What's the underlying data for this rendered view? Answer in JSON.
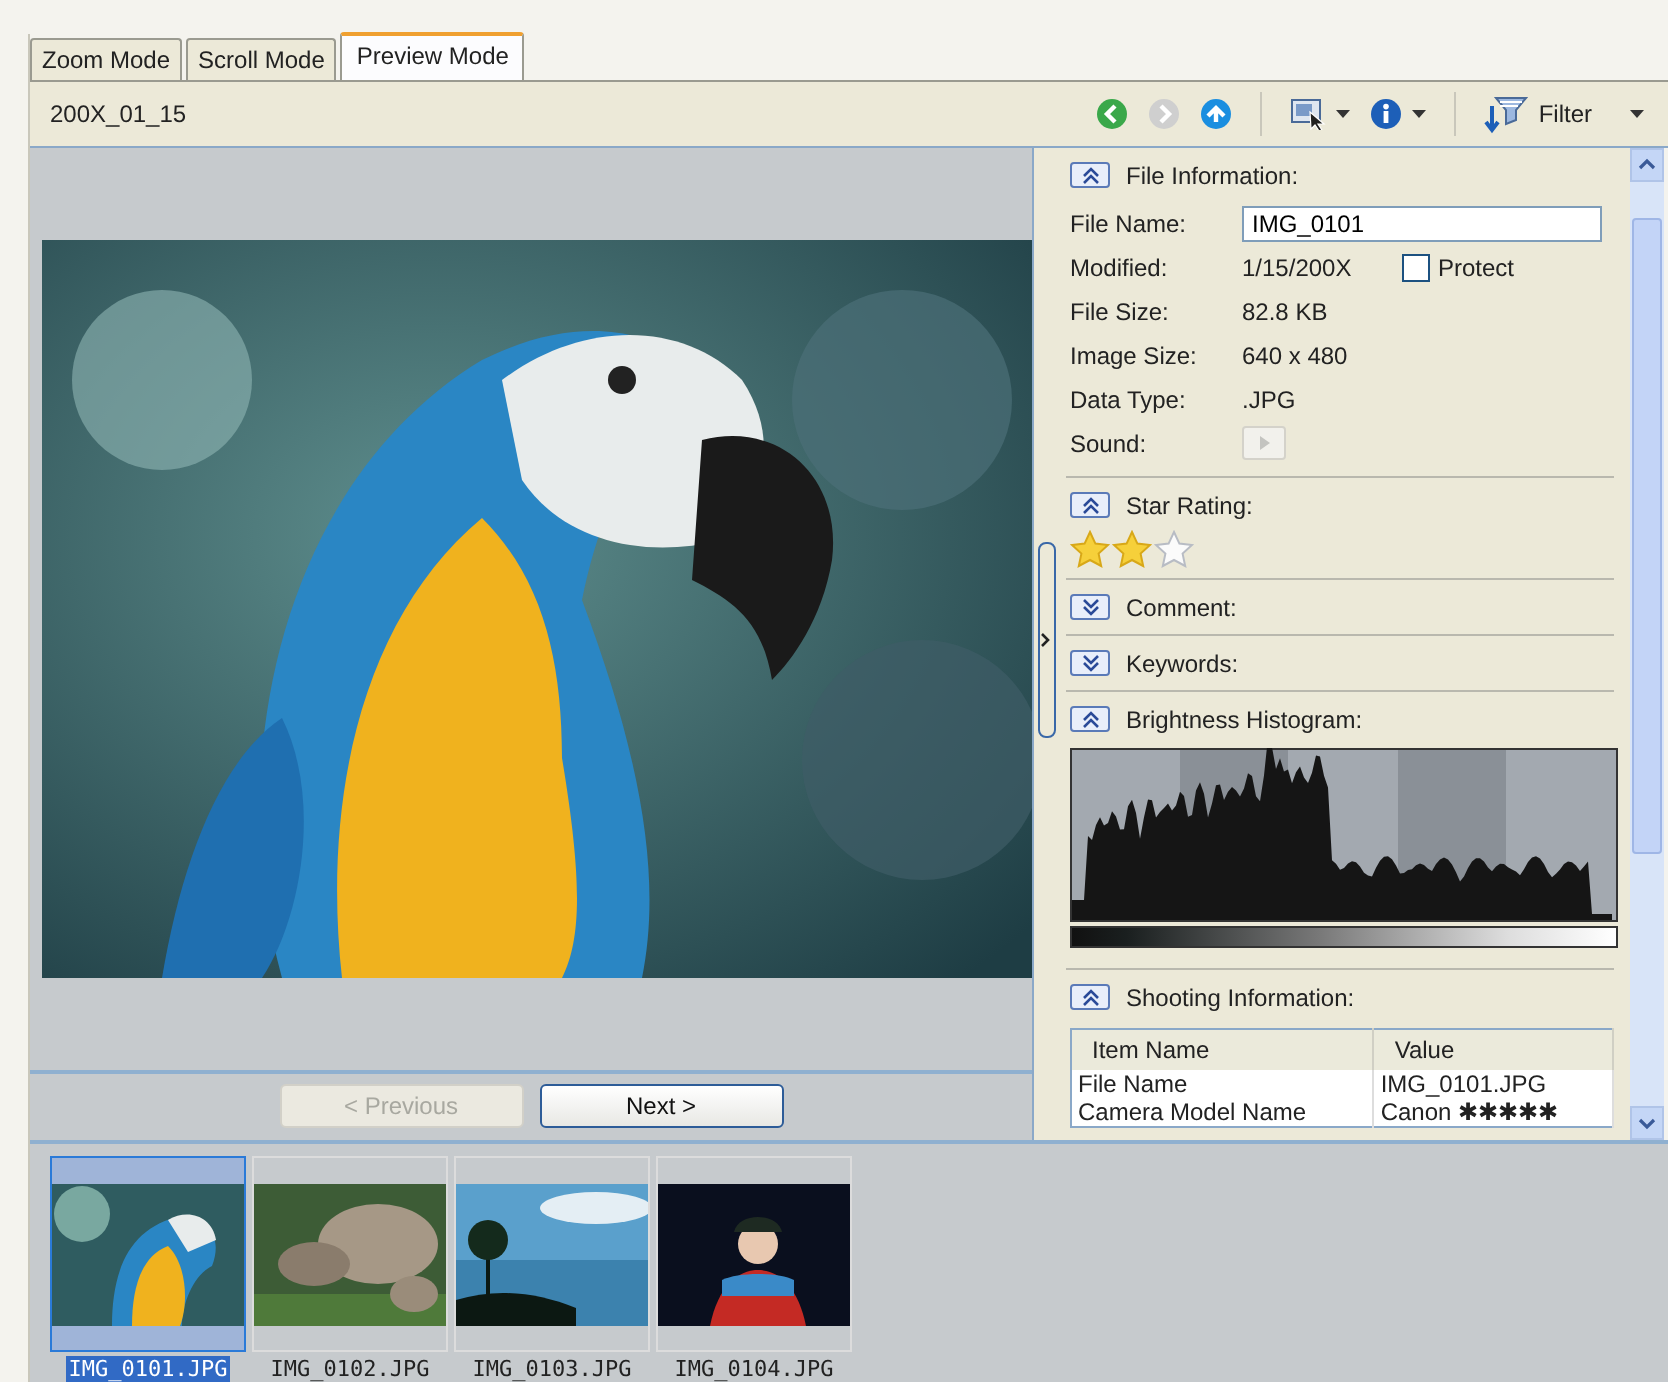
{
  "tabs": [
    {
      "label": "Zoom Mode",
      "selected": false
    },
    {
      "label": "Scroll Mode",
      "selected": false
    },
    {
      "label": "Preview Mode",
      "selected": true
    }
  ],
  "toolbar": {
    "title": "200X_01_15",
    "buttons": [
      {
        "kind": "back",
        "disabled": false
      },
      {
        "kind": "forward",
        "disabled": true
      },
      {
        "kind": "up",
        "disabled": false
      },
      {
        "kind": "view",
        "menu": true
      },
      {
        "kind": "info",
        "disabled": false,
        "menu": true
      },
      {
        "kind": "filter",
        "menu": true,
        "label": "Filter"
      }
    ]
  },
  "navigation": [
    {
      "label": "< Previous",
      "disabled": true
    },
    {
      "label": "Next >",
      "disabled": false
    }
  ],
  "sections": [
    {
      "kind": "file_info",
      "title": "File Information:",
      "expanded": true,
      "fields": [
        {
          "kind": "input",
          "label": "File Name:",
          "value": "IMG_0101"
        },
        {
          "kind": "text",
          "label": "Modified:",
          "value": "1/15/200X",
          "checkbox": {
            "label": "Protect",
            "checked": false
          }
        },
        {
          "kind": "text",
          "label": "File Size:",
          "value": "82.8 KB"
        },
        {
          "kind": "text",
          "label": "Image Size:",
          "value": "640 x 480"
        },
        {
          "kind": "text",
          "label": "Data Type:",
          "value": ".JPG"
        },
        {
          "kind": "play",
          "label": "Sound:",
          "disabled": true
        }
      ]
    },
    {
      "kind": "stars",
      "title": "Star Rating:",
      "expanded": true,
      "stars": 2
    },
    {
      "title": "Comment:",
      "expanded": false
    },
    {
      "title": "Keywords:",
      "expanded": false
    },
    {
      "kind": "histogram",
      "title": "Brightness Histogram:",
      "expanded": true
    },
    {
      "kind": "table",
      "title": "Shooting Information:",
      "expanded": true,
      "columns": [
        "Item Name",
        "Value"
      ],
      "rows": [
        [
          "File Name",
          "IMG_0101.JPG"
        ],
        [
          "Camera Model Name",
          "Canon ✱✱✱✱✱"
        ]
      ]
    }
  ],
  "thumbnails": [
    {
      "label": "IMG_0101.JPG",
      "selected": true
    },
    {
      "label": "IMG_0102.JPG",
      "selected": false
    },
    {
      "label": "IMG_0103.JPG",
      "selected": false
    },
    {
      "label": "IMG_0104.JPG",
      "selected": false
    }
  ]
}
